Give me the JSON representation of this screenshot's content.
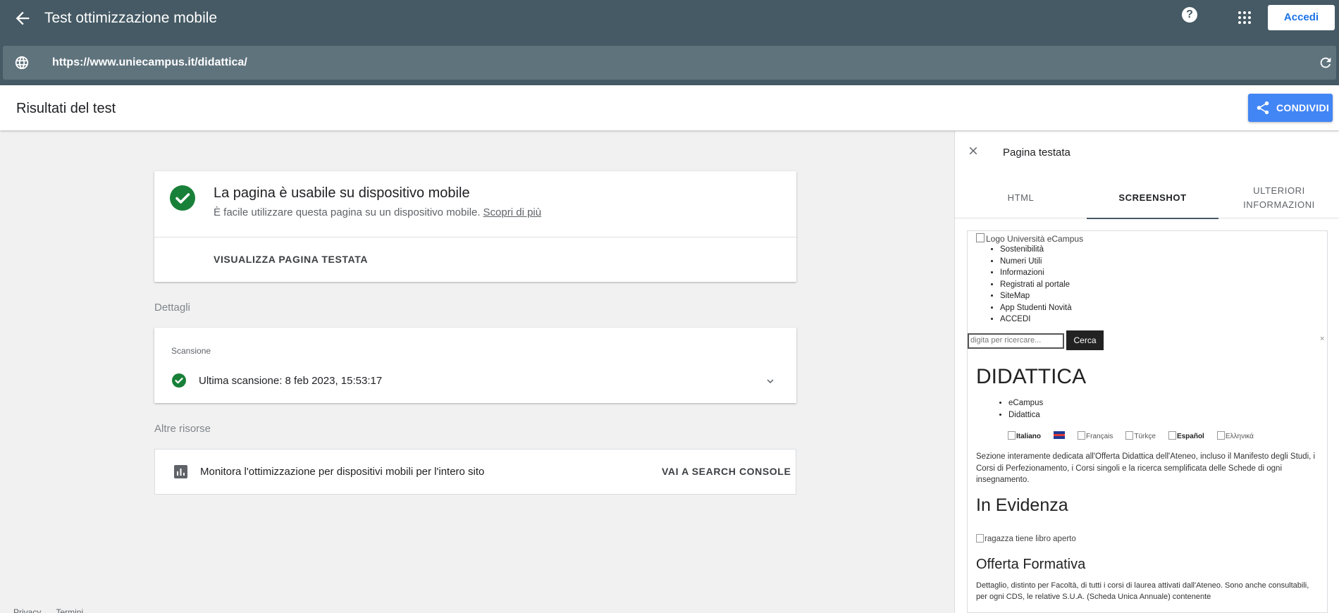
{
  "header": {
    "title": "Test ottimizzazione mobile",
    "help_label": "?",
    "login_label": "Accedi"
  },
  "urlbar": {
    "url": "https://www.uniecampus.it/didattica/"
  },
  "results": {
    "title": "Risultati del test",
    "share_label": "CONDIVIDI"
  },
  "result_card": {
    "title": "La pagina è usabile su dispositivo mobile",
    "subtitle": "È facile utilizzare questa pagina su un dispositivo mobile.",
    "learn_more": "Scopri di più",
    "view_page": "VISUALIZZA PAGINA TESTATA"
  },
  "details": {
    "label": "Dettagli",
    "scan_title": "Scansione",
    "scan_text": "Ultima scansione: 8 feb 2023, 15:53:17"
  },
  "resources": {
    "label": "Altre risorse",
    "text": "Monitora l'ottimizzazione per dispositivi mobili per l'intero sito",
    "link": "VAI A SEARCH CONSOLE"
  },
  "footer": {
    "privacy": "Privacy",
    "terms": "Termini"
  },
  "panel": {
    "title": "Pagina testata",
    "tabs": [
      "HTML",
      "SCREENSHOT",
      "ULTERIORI\nINFORMAZIONI"
    ],
    "active_tab": "SCREENSHOT"
  },
  "preview": {
    "logo_alt": "Logo Università eCampus",
    "menu": [
      "Sostenibilità",
      "Numeri Utili",
      "Informazioni",
      "Registrati al portale",
      "SiteMap",
      "App Studenti Novità",
      "ACCEDI"
    ],
    "search_placeholder": "digita per ricercare...",
    "search_button": "Cerca",
    "close_x": "×",
    "heading": "DIDATTICA",
    "breadcrumbs": [
      "eCampus",
      "Didattica"
    ],
    "languages": [
      "Italiano",
      "Français",
      "Türkçe",
      "Español",
      "Ελληνικά"
    ],
    "description": "Sezione interamente dedicata all'Offerta Didattica dell'Ateneo, incluso il Manifesto degli Studi, i Corsi di Perfezionamento, i Corsi singoli e la ricerca semplificata delle Schede di ogni insegnamento.",
    "highlight_heading": "In Evidenza",
    "image_alt": "ragazza tiene libro aperto",
    "offer_heading": "Offerta Formativa",
    "offer_text": "Dettaglio, distinto per Facoltà, di tutti i corsi di laurea attivati dall'Ateneo. Sono anche consultabili, per ogni CDS, le relative S.U.A. (Scheda Unica Annuale) contenente"
  },
  "colors": {
    "topbar": "#455a64",
    "urlbar": "#5f737d",
    "share": "#4285f4",
    "success": "#188038"
  }
}
